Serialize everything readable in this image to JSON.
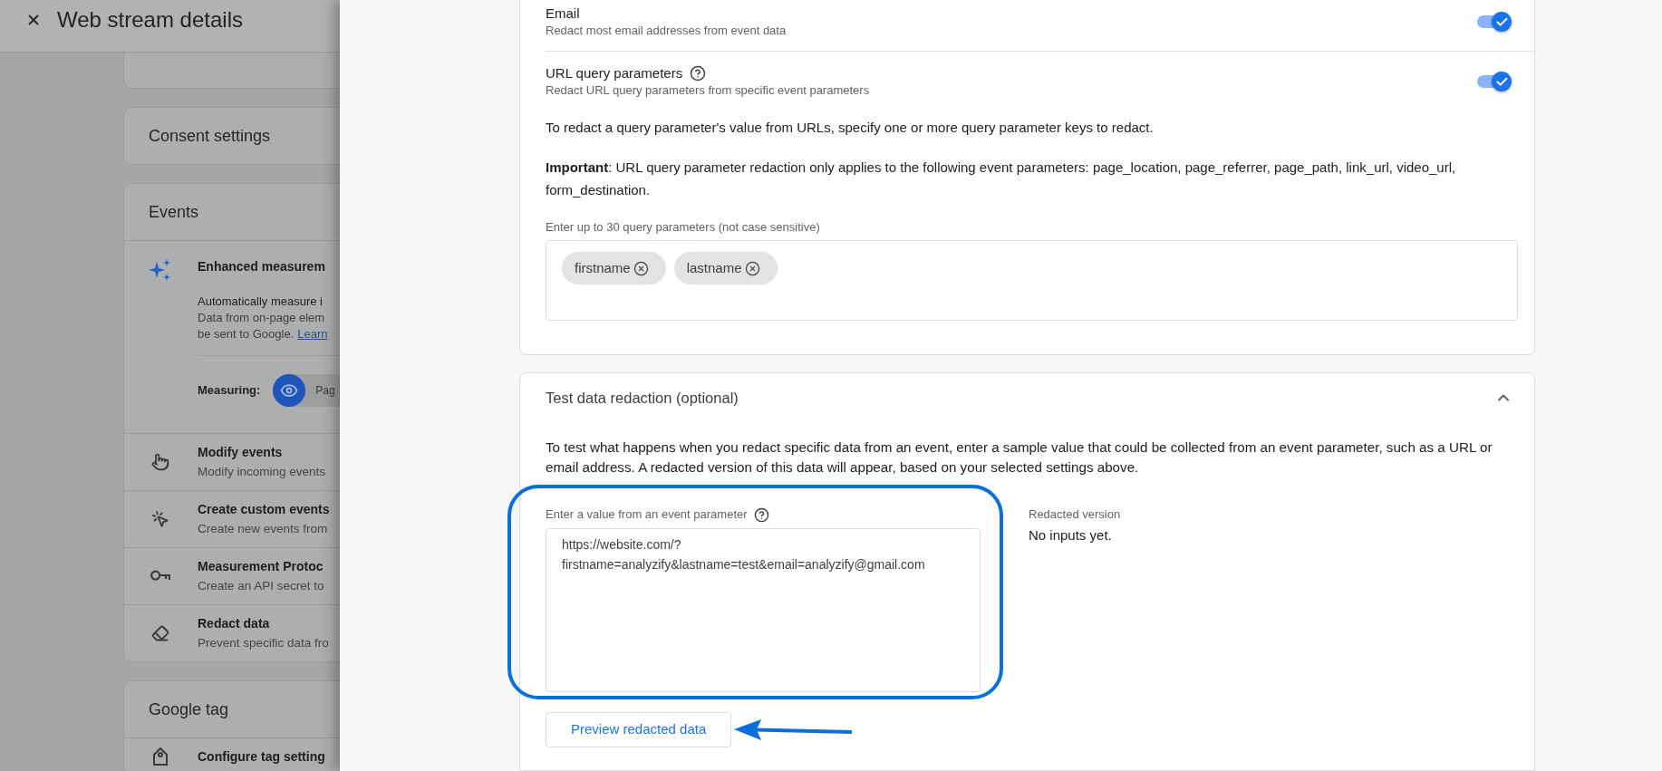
{
  "stream_page": {
    "title": "Web stream details",
    "sections": [
      {
        "title": "Consent settings"
      },
      {
        "title": "Events",
        "items": [
          {
            "kind": "feature",
            "title": "Enhanced measurem",
            "summary": "Automatically measure i",
            "details": [
              "Data from on-page elem",
              "be sent to Google."
            ],
            "link": "Learn",
            "measuring": {
              "label": "Measuring:",
              "option": "Pag"
            }
          },
          {
            "kind": "link",
            "title": "Modify events",
            "description": "Modify incoming events"
          },
          {
            "kind": "link",
            "title": "Create custom events",
            "description": "Create new events from"
          },
          {
            "kind": "link",
            "title": "Measurement Protoc",
            "description": "Create an API secret to"
          },
          {
            "kind": "link",
            "title": "Redact data",
            "description": "Prevent specific data fro"
          }
        ]
      },
      {
        "title": "Google tag",
        "items": [
          {
            "kind": "link",
            "title": "Configure tag setting"
          }
        ]
      }
    ]
  },
  "drawer": {
    "redaction_card": {
      "options": [
        {
          "title": "Email",
          "description": "Redact most email addresses from event data",
          "help": false,
          "on": true
        },
        {
          "title": "URL query parameters",
          "description": "Redact URL query parameters from specific event parameters",
          "help": true,
          "on": true
        }
      ],
      "instructions": "To redact a query parameter's value from URLs, specify one or more query parameter keys to redact.",
      "important": "**Important**: URL query parameter redaction only applies to the following event parameters: page_location, page_referrer, page_path, link_url, video_url, form_destination.",
      "parameters": {
        "label": "Enter up to 30 query parameters (not case sensitive)",
        "chips": [
          "firstname",
          "lastname"
        ]
      }
    },
    "test_card": {
      "title": "Test data redaction (optional)",
      "expanded": true,
      "description": "To test what happens when you redact specific data from an event, enter a sample value that could be collected from an event parameter, such as a URL or email address. A redacted version of this data will appear, based on your selected settings above.",
      "input": {
        "label": "Enter a value from an event parameter",
        "help": true,
        "value": "https://website.com/?firstname=analyzify&lastname=test&email=analyzify@gmail.com"
      },
      "output": {
        "label": "Redacted version",
        "value": "No inputs yet."
      },
      "button": "Preview redacted data"
    }
  }
}
